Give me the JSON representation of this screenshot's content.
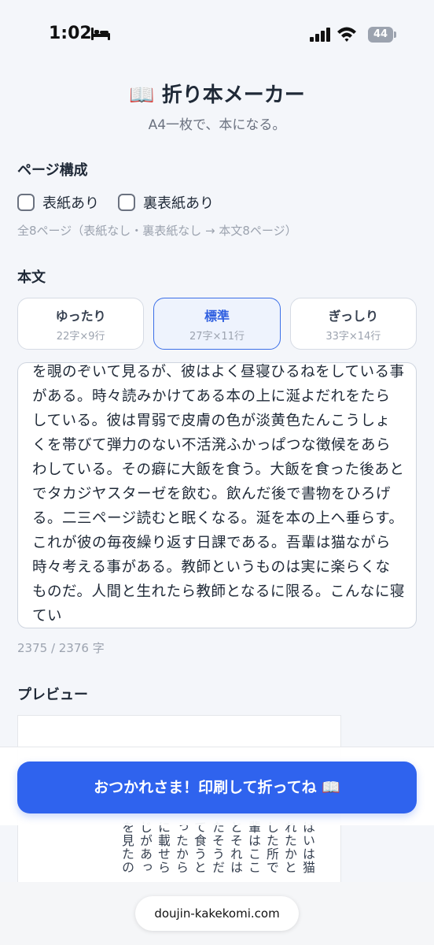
{
  "status": {
    "time": "1:02",
    "battery": "44"
  },
  "header": {
    "title": "📖 折り本メーカー",
    "subtitle": "A4一枚で、本になる。"
  },
  "page_config": {
    "label": "ページ構成",
    "cover_front": {
      "label": "表紙あり",
      "checked": false
    },
    "cover_back": {
      "label": "裏表紙あり",
      "checked": false
    },
    "summary": "全8ページ（表紙なし・裏表紙なし → 本文8ページ）"
  },
  "body_section": {
    "label": "本文",
    "density_options": [
      {
        "name": "ゆったり",
        "spec": "22字×9行",
        "selected": false
      },
      {
        "name": "標準",
        "spec": "27字×11行",
        "selected": true
      },
      {
        "name": "ぎっしり",
        "spec": "33字×14行",
        "selected": false
      }
    ],
    "text": "を覗のぞいて見るが、彼はよく昼寝ひるねをしている事がある。時々読みかけてある本の上に涎よだれをたらしている。彼は胃弱で皮膚の色が淡黄色たんこうしょくを帯びて弾力のない不活溌ふかっぱつな徴候をあらわしている。その癖に大飯を食う。大飯を食った後あとでタカジヤスターゼを飲む。飲んだ後で書物をひろげる。二三ページ読むと眠くなる。涎を本の上へ垂らす。これが彼の毎夜繰り返す日課である。吾輩は猫ながら時々考える事がある。教師というものは実に楽らくなものだ。人間と生れたら教師となるに限る。こんなに寝てい",
    "char_count": "2375 / 2376 字"
  },
  "preview": {
    "label": "プレビュー",
    "columns": [
      "はいは猫",
      "れたかと",
      "した所で",
      "輩はここ",
      "とそれは",
      "たそうだ",
      "て食うと",
      "ったから",
      "に載せら",
      "じがあっ",
      "を見たの"
    ]
  },
  "cta": {
    "label": "おつかれさま！印刷して折ってね 📖"
  },
  "browser": {
    "url": "doujin-kakekomi.com"
  },
  "colors": {
    "accent": "#2f63ee",
    "selected_border": "#3b6fe8",
    "background": "#f4f6fa"
  }
}
